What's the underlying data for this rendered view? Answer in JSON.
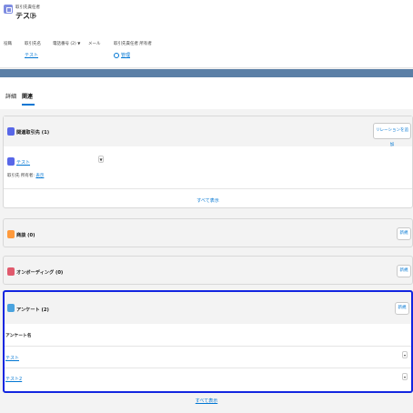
{
  "header": {
    "object_label": "取引先責任者",
    "record_title": "テスト",
    "fields": [
      {
        "label": "役職",
        "value": ""
      },
      {
        "label": "取引先名",
        "value": "テスト"
      },
      {
        "label": "電話番号 (2)",
        "value": ""
      },
      {
        "label": "メール",
        "value": ""
      },
      {
        "label": "取引先責任者 所有者",
        "value": "管理"
      }
    ]
  },
  "tabs": [
    {
      "label": "詳細"
    },
    {
      "label": "関連"
    }
  ],
  "related_accounts": {
    "title": "関連取引先 (1)",
    "button": "リレーションを追加",
    "item_name": "テスト",
    "item_field_label": "取引先 所有者:",
    "item_field_value": "表示",
    "view_all": "すべて表示"
  },
  "opportunities": {
    "title": "商談 (0)",
    "button": "新規"
  },
  "onboarding": {
    "title": "オンボーディング (0)",
    "button": "新規"
  },
  "surveys": {
    "title": "アンケート (2)",
    "button": "新規",
    "column_header": "アンケート名",
    "rows": [
      {
        "name": "テスト"
      },
      {
        "name": "テスト2"
      }
    ],
    "view_all": "すべて表示"
  },
  "colors": {
    "accent": "#0176d3",
    "highlight": "#1226e0",
    "contact_icon": "#7f8de1",
    "accounts_icon": "#5867e8",
    "opportunity_icon": "#ff9a3c",
    "onboarding_icon": "#e05a6d",
    "survey_icon": "#4aa3df"
  }
}
